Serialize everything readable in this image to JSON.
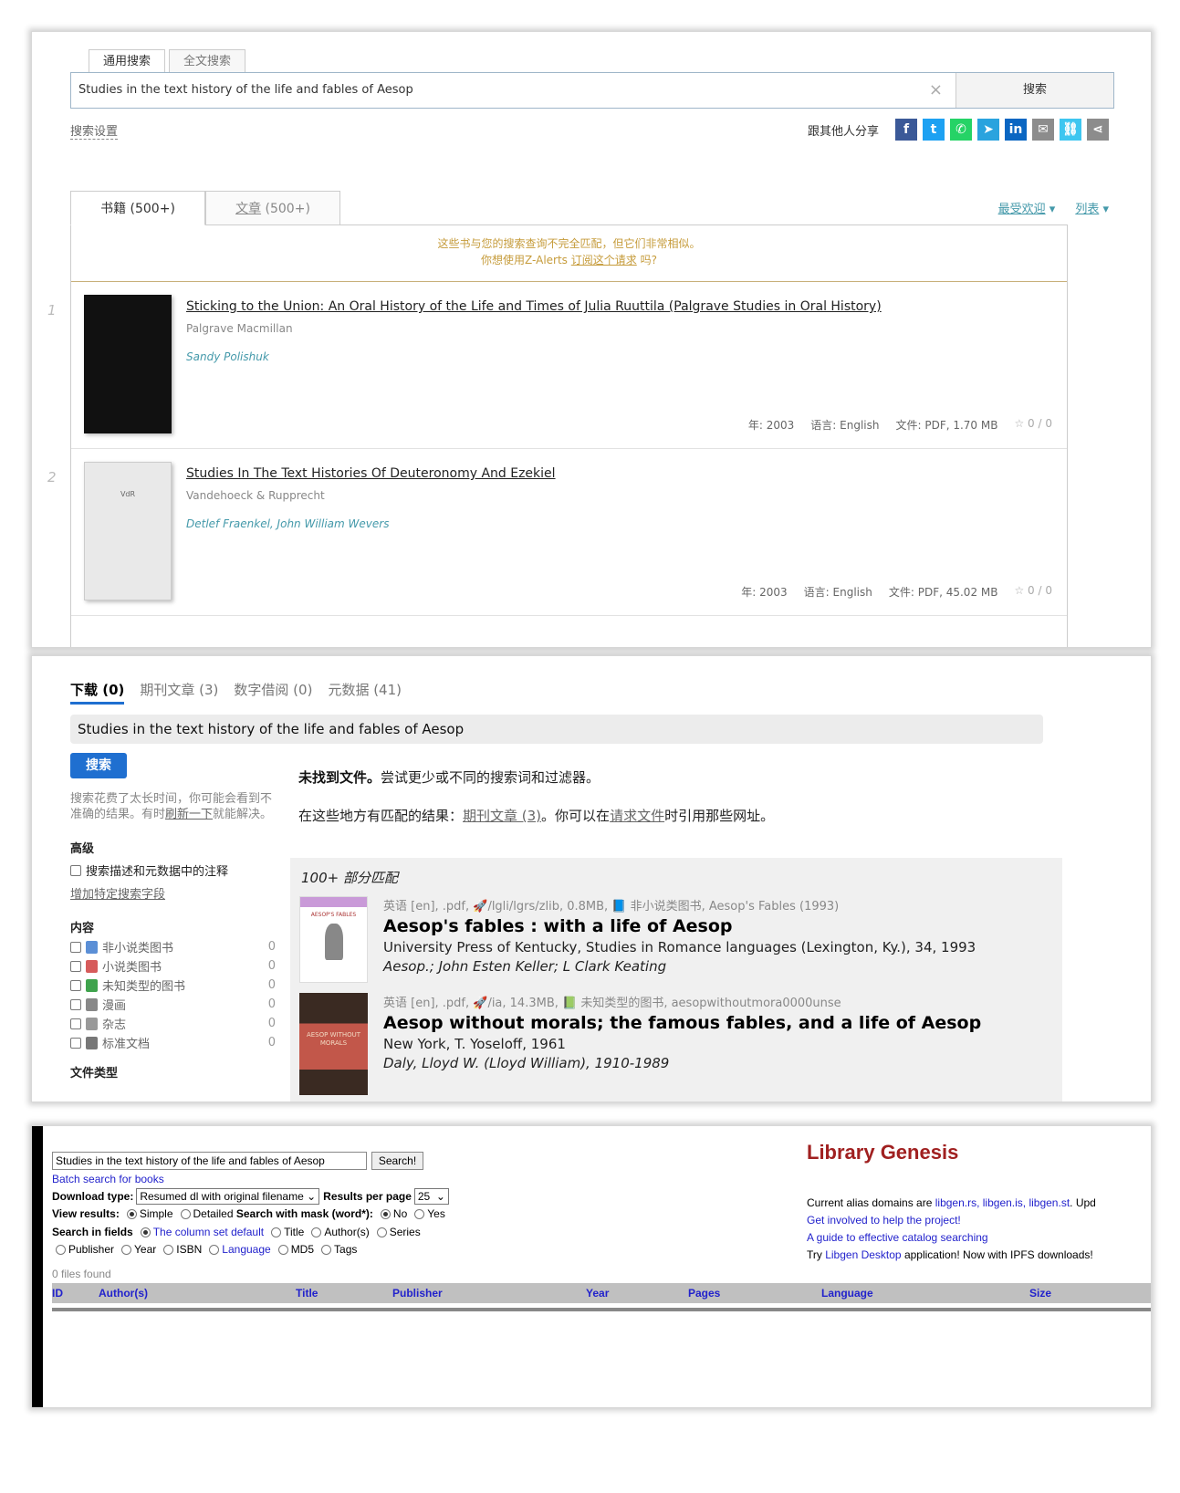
{
  "zlib": {
    "tabs": [
      "通用搜索",
      "全文搜索"
    ],
    "search_value": "Studies in the text history of the life and fables of Aesop",
    "clear_icon": "×",
    "search_button": "搜索",
    "settings_link": "搜索设置",
    "share_label": "跟其他人分享",
    "share_icons": [
      "facebook-icon",
      "twitter-icon",
      "whatsapp-icon",
      "telegram-icon",
      "linkedin-icon",
      "email-icon",
      "link-icon",
      "share-icon"
    ],
    "result_tabs": {
      "books": "书籍",
      "books_count": "(500+)",
      "articles": "文章",
      "articles_count": "(500+)"
    },
    "sort": {
      "popular": "最受欢迎",
      "view": "列表"
    },
    "notice_line1": "这些书与您的搜索查询不完全匹配，但它们非常相似。",
    "notice_line2_pre": "你想使用Z-Alerts ",
    "notice_line2_link": "订阅这个请求",
    "notice_line2_post": " 吗?",
    "results": [
      {
        "num": "1",
        "title": "Sticking to the Union: An Oral History of the Life and Times of Julia Ruuttila (Palgrave Studies in Oral History)",
        "publisher": "Palgrave Macmillan",
        "authors": "Sandy Polishuk",
        "year": "年: 2003",
        "language": "语言: English",
        "file": "文件: PDF, 1.70 MB",
        "rating": "☆ 0 / 0"
      },
      {
        "num": "2",
        "title": "Studies In The Text Histories Of Deuteronomy And Ezekiel",
        "publisher": "Vandehoeck & Rupprecht",
        "authors": "Detlef Fraenkel, John William Wevers",
        "cover_text": "VdR",
        "year": "年: 2003",
        "language": "语言: English",
        "file": "文件: PDF, 45.02 MB",
        "rating": "☆ 0 / 0"
      }
    ]
  },
  "anna": {
    "tabs": [
      "下载 (0)",
      "期刊文章 (3)",
      "数字借阅 (0)",
      "元数据 (41)"
    ],
    "search_value": "Studies in the text history of the life and fables of Aesop",
    "search_button": "搜索",
    "slow_note_pre": "搜索花费了太长时间，你可能会看到不准确的结果。有时",
    "slow_note_link": "刷新一下",
    "slow_note_post": "就能解决。",
    "advanced_heading": "高级",
    "advanced_checkbox": "搜索描述和元数据中的注释",
    "add_field_link": "增加特定搜索字段",
    "content_heading": "内容",
    "categories": [
      {
        "label": "非小说类图书",
        "count": "0",
        "color": "#5b8fd6"
      },
      {
        "label": "小说类图书",
        "count": "0",
        "color": "#d65b5b"
      },
      {
        "label": "未知类型的图书",
        "count": "0",
        "color": "#3fa34d"
      },
      {
        "label": "漫画",
        "count": "0",
        "color": "#888888"
      },
      {
        "label": "杂志",
        "count": "0",
        "color": "#999999"
      },
      {
        "label": "标准文档",
        "count": "0",
        "color": "#777777"
      }
    ],
    "filetype_heading": "文件类型",
    "not_found_bold": "未找到文件。",
    "not_found_rest": "尝试更少或不同的搜索词和过滤器。",
    "elsewhere_pre": "在这些地方有匹配的结果：",
    "elsewhere_link": "期刊文章 (3)",
    "elsewhere_mid": "。你可以在",
    "elsewhere_link2": "请求文件",
    "elsewhere_post": "时引用那些网址。",
    "partial_header": "100+ 部分匹配",
    "items": [
      {
        "meta": "英语 [en], .pdf, 🚀/lgli/lgrs/zlib, 0.8MB, 📘 非小说类图书, Aesop's Fables (1993)",
        "title": "Aesop's fables : with a life of Aesop",
        "publisher": "University Press of Kentucky, Studies in Romance languages (Lexington, Ky.), 34, 1993",
        "authors": "Aesop.; John Esten Keller; L Clark Keating",
        "thumb_text": "AESOP'S FABLES"
      },
      {
        "meta": "英语 [en], .pdf, 🚀/ia, 14.3MB, 📗 未知类型的图书, aesopwithoutmora0000unse",
        "title": "Aesop without morals; the famous fables, and a life of Aesop",
        "publisher": "New York, T. Yoseloff, 1961",
        "authors": "Daly, Lloyd W. (Lloyd William), 1910-1989",
        "thumb_text": "AESOP WITHOUT MORALS"
      }
    ]
  },
  "libgen": {
    "search_value": "Studies in the text history of the life and fables of Aesop",
    "search_button": "Search!",
    "batch_link": "Batch search for books",
    "download_type_label": "Download type:",
    "download_type_value": "Resumed dl with original filename",
    "results_per_page_label": "Results per page",
    "results_per_page_value": "25",
    "view_results_label": "View results:",
    "view_simple": "Simple",
    "view_detailed": "Detailed",
    "mask_label": "Search with mask (word*):",
    "mask_no": "No",
    "mask_yes": "Yes",
    "fields_label": "Search in fields",
    "fields_default": "The column set default",
    "fields_title": "Title",
    "fields_author": "Author(s)",
    "fields_series": "Series",
    "fields_publisher": "Publisher",
    "fields_year": "Year",
    "fields_isbn": "ISBN",
    "fields_language": "Language",
    "fields_md5": "MD5",
    "fields_tags": "Tags",
    "files_found": "0 files found",
    "columns": [
      "ID",
      "Author(s)",
      "Title",
      "Publisher",
      "Year",
      "Pages",
      "Language",
      "Size"
    ],
    "logo": "Library Genesis",
    "alias_pre": "Current alias domains are ",
    "alias_domains": "libgen.rs, libgen.is, libgen.st",
    "alias_post": ". Upd",
    "involved_link": "Get involved to help the project!",
    "guide_link": "A guide to effective catalog searching",
    "desktop_pre": "Try ",
    "desktop_link": "Libgen Desktop",
    "desktop_post": " application! Now with IPFS downloads!"
  }
}
